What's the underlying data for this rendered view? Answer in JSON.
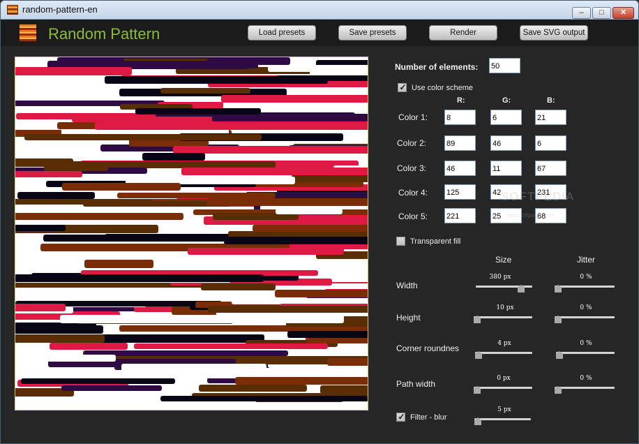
{
  "window": {
    "title": "random-pattern-en",
    "minimize_glyph": "‒",
    "maximize_glyph": "□",
    "close_glyph": "✕"
  },
  "header": {
    "app_title": "Random Pattern",
    "buttons": {
      "load": "Load presets",
      "save": "Save presets",
      "render": "Render",
      "svg": "Save SVG output"
    }
  },
  "settings": {
    "num_elements_label": "Number of elements:",
    "num_elements": "50",
    "use_color_scheme_label": "Use color scheme",
    "use_color_scheme": true,
    "channels": {
      "r": "R:",
      "g": "G:",
      "b": "B:"
    },
    "colors": [
      {
        "label": "Color 1:",
        "r": "8",
        "g": "6",
        "b": "21"
      },
      {
        "label": "Color  2:",
        "r": "89",
        "g": "46",
        "b": "6"
      },
      {
        "label": "Color  3:",
        "r": "46",
        "g": "11",
        "b": "67"
      },
      {
        "label": "Color 4:",
        "r": "125",
        "g": "42",
        "b": "231"
      },
      {
        "label": "Color 5:",
        "r": "221",
        "g": "25",
        "b": "68"
      }
    ],
    "transparent_fill_label": "Transparent fill",
    "transparent_fill": false,
    "size_header": "Size",
    "jitter_header": "Jitter",
    "params": [
      {
        "label": "Width",
        "size": "380 px",
        "size_frac": 0.85,
        "jitter": "0 %",
        "jitter_frac": 0.0
      },
      {
        "label": "Height",
        "size": "10 px",
        "size_frac": 0.0,
        "jitter": "0 %",
        "jitter_frac": 0.0
      },
      {
        "label": "Corner roundnes",
        "size": "4 px",
        "size_frac": 0.0,
        "jitter": "0 %",
        "jitter_frac": 0.0
      },
      {
        "label": "Path width",
        "size": "0 px",
        "size_frac": 0.0,
        "jitter": "0 %",
        "jitter_frac": 0.0
      }
    ],
    "filter_blur_label": "Filter - blur",
    "filter_blur": true,
    "blur_value": "5 px",
    "blur_frac": 0.0
  },
  "palette": [
    "#080615",
    "#592e06",
    "#2e0b43",
    "#dd1944",
    "#7a2d06",
    "#ffffff"
  ],
  "watermark": {
    "main": "SOFTPEDIA",
    "sub": "www.softpedia.com"
  }
}
